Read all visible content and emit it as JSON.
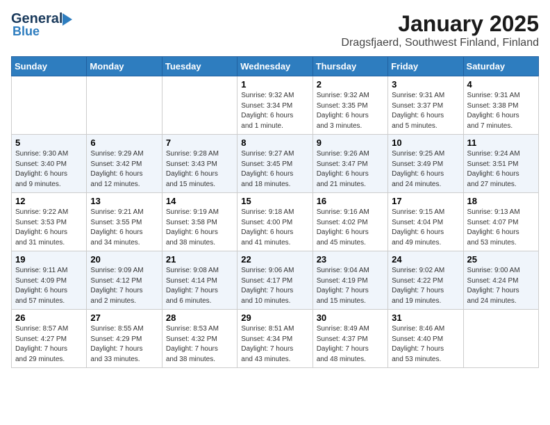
{
  "header": {
    "logo_general": "General",
    "logo_blue": "Blue",
    "month": "January 2025",
    "location": "Dragsfjaerd, Southwest Finland, Finland"
  },
  "days_of_week": [
    "Sunday",
    "Monday",
    "Tuesday",
    "Wednesday",
    "Thursday",
    "Friday",
    "Saturday"
  ],
  "weeks": [
    [
      {
        "day": "",
        "info": ""
      },
      {
        "day": "",
        "info": ""
      },
      {
        "day": "",
        "info": ""
      },
      {
        "day": "1",
        "info": "Sunrise: 9:32 AM\nSunset: 3:34 PM\nDaylight: 6 hours\nand 1 minute."
      },
      {
        "day": "2",
        "info": "Sunrise: 9:32 AM\nSunset: 3:35 PM\nDaylight: 6 hours\nand 3 minutes."
      },
      {
        "day": "3",
        "info": "Sunrise: 9:31 AM\nSunset: 3:37 PM\nDaylight: 6 hours\nand 5 minutes."
      },
      {
        "day": "4",
        "info": "Sunrise: 9:31 AM\nSunset: 3:38 PM\nDaylight: 6 hours\nand 7 minutes."
      }
    ],
    [
      {
        "day": "5",
        "info": "Sunrise: 9:30 AM\nSunset: 3:40 PM\nDaylight: 6 hours\nand 9 minutes."
      },
      {
        "day": "6",
        "info": "Sunrise: 9:29 AM\nSunset: 3:42 PM\nDaylight: 6 hours\nand 12 minutes."
      },
      {
        "day": "7",
        "info": "Sunrise: 9:28 AM\nSunset: 3:43 PM\nDaylight: 6 hours\nand 15 minutes."
      },
      {
        "day": "8",
        "info": "Sunrise: 9:27 AM\nSunset: 3:45 PM\nDaylight: 6 hours\nand 18 minutes."
      },
      {
        "day": "9",
        "info": "Sunrise: 9:26 AM\nSunset: 3:47 PM\nDaylight: 6 hours\nand 21 minutes."
      },
      {
        "day": "10",
        "info": "Sunrise: 9:25 AM\nSunset: 3:49 PM\nDaylight: 6 hours\nand 24 minutes."
      },
      {
        "day": "11",
        "info": "Sunrise: 9:24 AM\nSunset: 3:51 PM\nDaylight: 6 hours\nand 27 minutes."
      }
    ],
    [
      {
        "day": "12",
        "info": "Sunrise: 9:22 AM\nSunset: 3:53 PM\nDaylight: 6 hours\nand 31 minutes."
      },
      {
        "day": "13",
        "info": "Sunrise: 9:21 AM\nSunset: 3:55 PM\nDaylight: 6 hours\nand 34 minutes."
      },
      {
        "day": "14",
        "info": "Sunrise: 9:19 AM\nSunset: 3:58 PM\nDaylight: 6 hours\nand 38 minutes."
      },
      {
        "day": "15",
        "info": "Sunrise: 9:18 AM\nSunset: 4:00 PM\nDaylight: 6 hours\nand 41 minutes."
      },
      {
        "day": "16",
        "info": "Sunrise: 9:16 AM\nSunset: 4:02 PM\nDaylight: 6 hours\nand 45 minutes."
      },
      {
        "day": "17",
        "info": "Sunrise: 9:15 AM\nSunset: 4:04 PM\nDaylight: 6 hours\nand 49 minutes."
      },
      {
        "day": "18",
        "info": "Sunrise: 9:13 AM\nSunset: 4:07 PM\nDaylight: 6 hours\nand 53 minutes."
      }
    ],
    [
      {
        "day": "19",
        "info": "Sunrise: 9:11 AM\nSunset: 4:09 PM\nDaylight: 6 hours\nand 57 minutes."
      },
      {
        "day": "20",
        "info": "Sunrise: 9:09 AM\nSunset: 4:12 PM\nDaylight: 7 hours\nand 2 minutes."
      },
      {
        "day": "21",
        "info": "Sunrise: 9:08 AM\nSunset: 4:14 PM\nDaylight: 7 hours\nand 6 minutes."
      },
      {
        "day": "22",
        "info": "Sunrise: 9:06 AM\nSunset: 4:17 PM\nDaylight: 7 hours\nand 10 minutes."
      },
      {
        "day": "23",
        "info": "Sunrise: 9:04 AM\nSunset: 4:19 PM\nDaylight: 7 hours\nand 15 minutes."
      },
      {
        "day": "24",
        "info": "Sunrise: 9:02 AM\nSunset: 4:22 PM\nDaylight: 7 hours\nand 19 minutes."
      },
      {
        "day": "25",
        "info": "Sunrise: 9:00 AM\nSunset: 4:24 PM\nDaylight: 7 hours\nand 24 minutes."
      }
    ],
    [
      {
        "day": "26",
        "info": "Sunrise: 8:57 AM\nSunset: 4:27 PM\nDaylight: 7 hours\nand 29 minutes."
      },
      {
        "day": "27",
        "info": "Sunrise: 8:55 AM\nSunset: 4:29 PM\nDaylight: 7 hours\nand 33 minutes."
      },
      {
        "day": "28",
        "info": "Sunrise: 8:53 AM\nSunset: 4:32 PM\nDaylight: 7 hours\nand 38 minutes."
      },
      {
        "day": "29",
        "info": "Sunrise: 8:51 AM\nSunset: 4:34 PM\nDaylight: 7 hours\nand 43 minutes."
      },
      {
        "day": "30",
        "info": "Sunrise: 8:49 AM\nSunset: 4:37 PM\nDaylight: 7 hours\nand 48 minutes."
      },
      {
        "day": "31",
        "info": "Sunrise: 8:46 AM\nSunset: 4:40 PM\nDaylight: 7 hours\nand 53 minutes."
      },
      {
        "day": "",
        "info": ""
      }
    ]
  ]
}
